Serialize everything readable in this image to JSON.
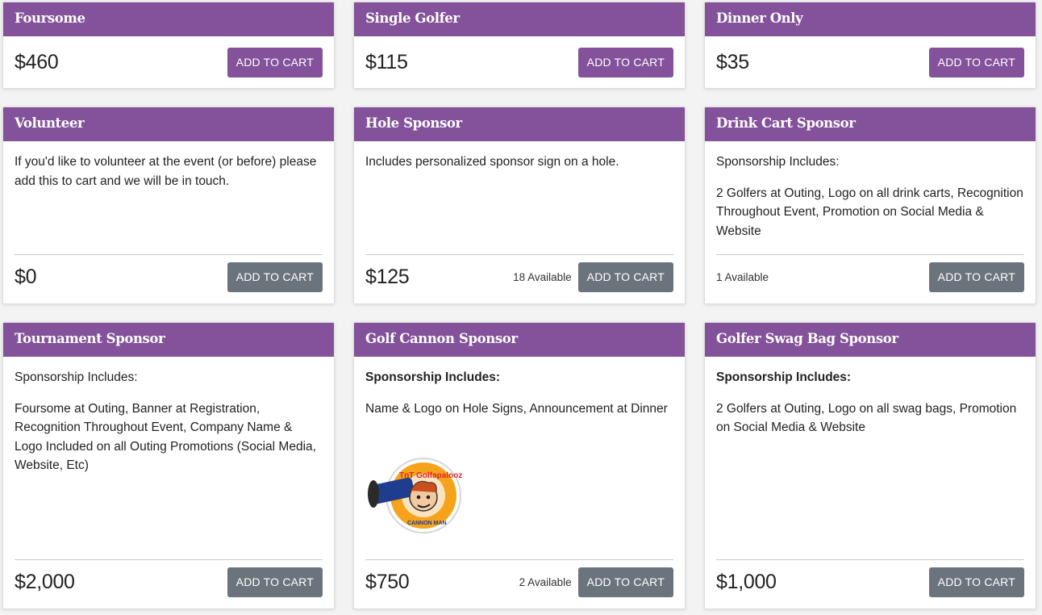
{
  "colors": {
    "header": "#83529b",
    "button_purple": "#83529b",
    "button_gray": "#6b747c"
  },
  "cards": [
    {
      "title": "Foursome",
      "price": "$460",
      "button": "ADD TO CART"
    },
    {
      "title": "Single Golfer",
      "price": "$115",
      "button": "ADD TO CART"
    },
    {
      "title": "Dinner Only",
      "price": "$35",
      "button": "ADD TO CART"
    },
    {
      "title": "Volunteer",
      "description": "If you'd like to volunteer at the event (or before) please add this to cart and we will be in touch.",
      "price": "$0",
      "button": "ADD TO CART"
    },
    {
      "title": "Hole Sponsor",
      "description": "Includes personalized sponsor sign on a hole.",
      "price": "$125",
      "available": "18 Available",
      "button": "ADD TO CART"
    },
    {
      "title": "Drink Cart Sponsor",
      "intro": "Sponsorship Includes:",
      "details": "2 Golfers at Outing, Logo on all drink carts, Recognition Throughout Event, Promotion on Social Media & Website",
      "available": "1 Available",
      "button": "ADD TO CART"
    },
    {
      "title": "Tournament Sponsor",
      "intro": "Sponsorship Includes:",
      "details": "Foursome at Outing, Banner at Registration, Recognition Throughout Event, Company Name & Logo Included on all Outing Promotions (Social Media, Website, Etc)",
      "price": "$2,000",
      "button": "ADD TO CART"
    },
    {
      "title": "Golf Cannon Sponsor",
      "intro": "Sponsorship Includes:",
      "details": "Name & Logo on Hole Signs, Announcement at Dinner",
      "logo_text": "TnT Golfapalooza",
      "logo_subtext": "CANNON MAN",
      "price": "$750",
      "available": "2 Available",
      "button": "ADD TO CART"
    },
    {
      "title": "Golfer Swag Bag Sponsor",
      "intro": "Sponsorship Includes:",
      "details": "2 Golfers at Outing, Logo on all swag bags, Promotion on Social Media & Website",
      "price": "$1,000",
      "button": "ADD TO CART"
    }
  ]
}
